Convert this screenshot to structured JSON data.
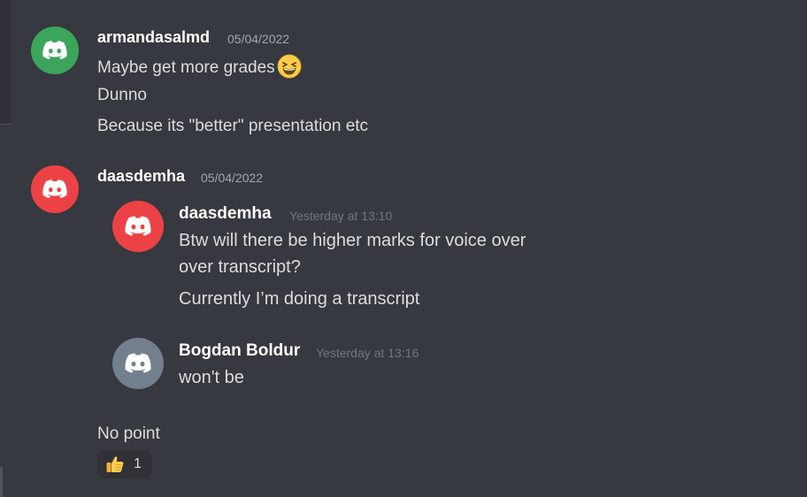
{
  "messages": [
    {
      "username": "armandasalmd",
      "timestamp": "05/04/2022",
      "avatar_color": "#3ba55c",
      "lines": [
        "Maybe get more grades",
        "Dunno",
        "Because its \"better\" presentation etc"
      ],
      "emoji": "grinning-squinting-face"
    },
    {
      "username": "daasdemha",
      "timestamp": "05/04/2022",
      "avatar_color": "#ed4245",
      "quoted": [
        {
          "username": "daasdemha",
          "timestamp": "Yesterday at 13:10",
          "avatar_color": "#ed4245",
          "lines": [
            "Btw will there be higher marks for voice over",
            "over transcript?",
            "Currently I’m doing a transcript"
          ]
        },
        {
          "username": "Bogdan Boldur",
          "timestamp": "Yesterday at 13:16",
          "avatar_color": "#747f8d",
          "lines": [
            "won't be"
          ]
        }
      ],
      "lines": [
        "No point"
      ],
      "reaction": {
        "emoji": "thumbs-up",
        "count": "1"
      }
    }
  ]
}
